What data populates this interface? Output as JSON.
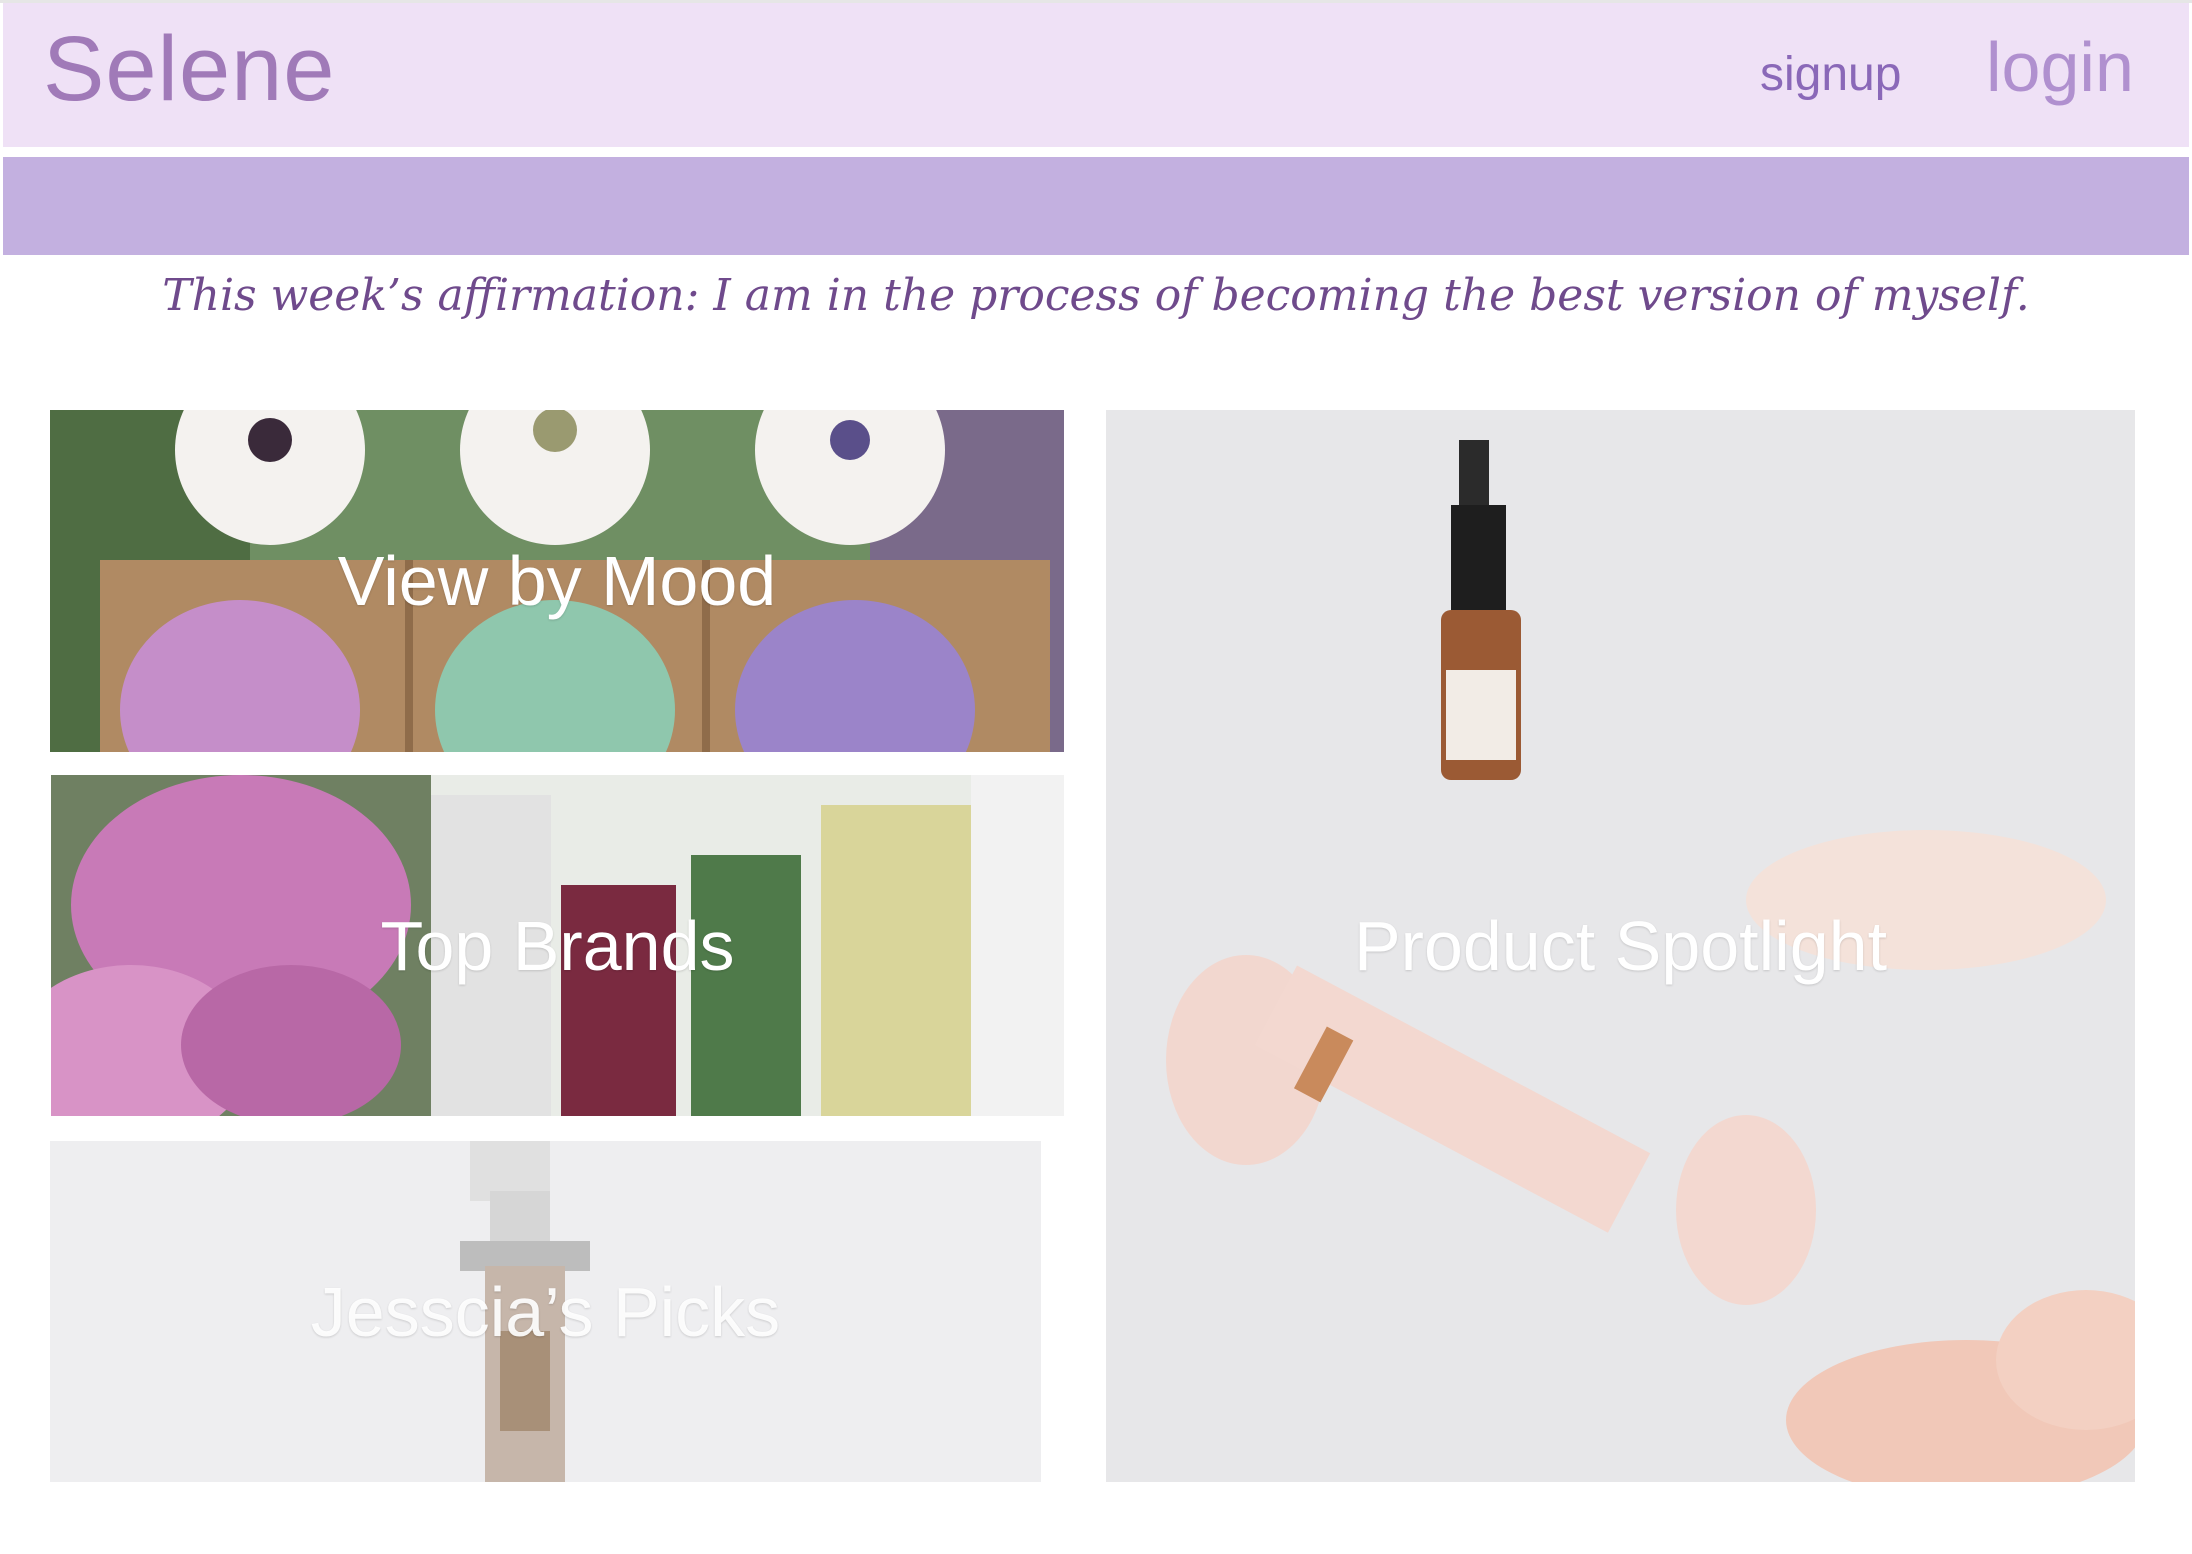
{
  "header": {
    "brand": "Selene",
    "signup_label": "signup",
    "login_label": "login"
  },
  "affirmation": "This week’s affirmation: I am in the process of becoming the best version of myself.",
  "tiles": {
    "mood": {
      "label": "View by Mood"
    },
    "brands": {
      "label": "Top Brands"
    },
    "picks": {
      "label": "Jesscia’s Picks"
    },
    "spotlight": {
      "label": "Product Spotlight"
    }
  },
  "colors": {
    "header_bg": "#efe1f6",
    "band_bg": "#c3b0e0",
    "brand_text": "#a07ab8",
    "affirmation_text": "#6f4a8c"
  }
}
